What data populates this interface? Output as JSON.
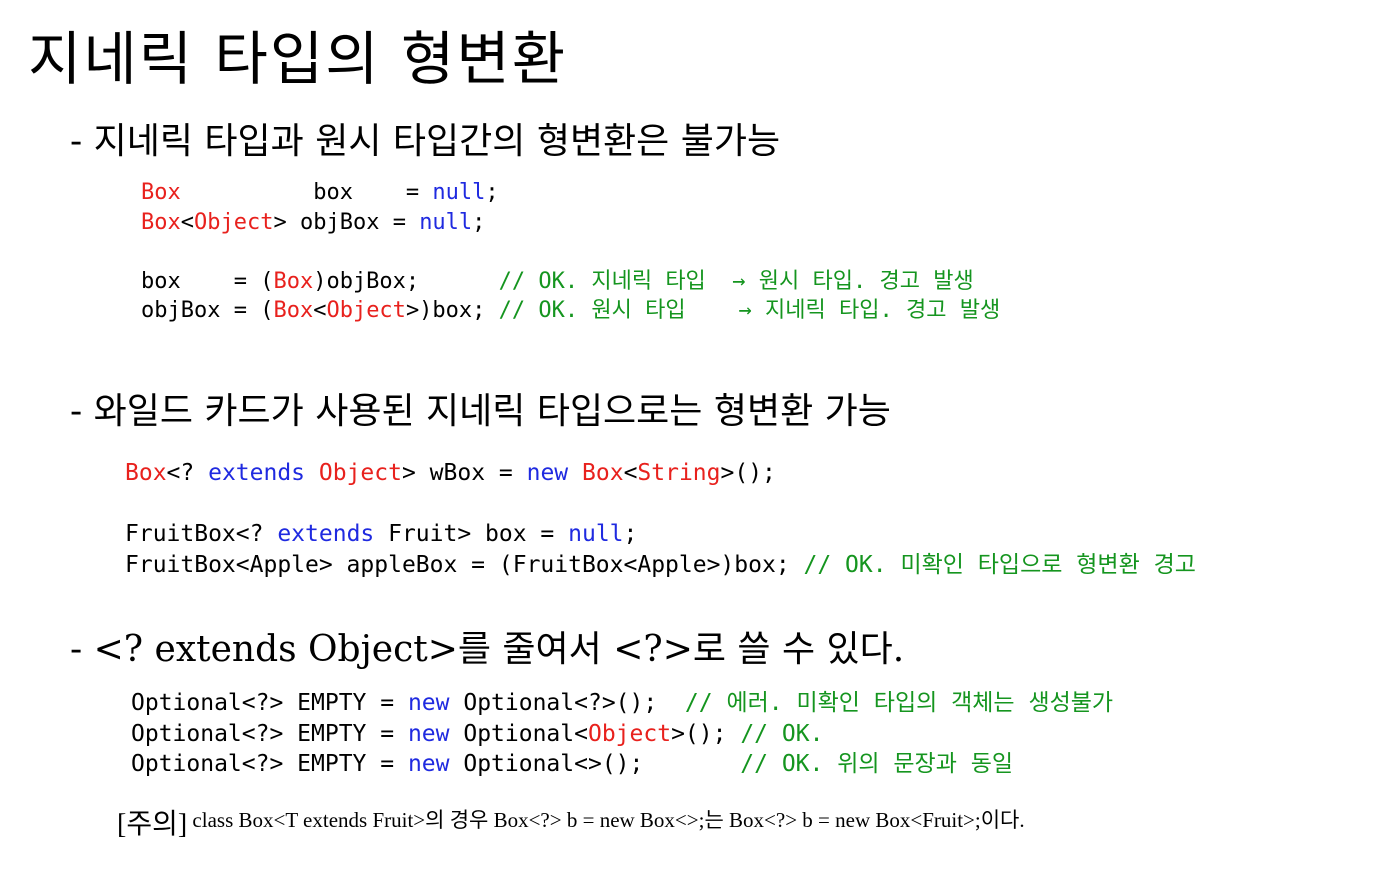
{
  "title": "지네릭 타입의 형변환",
  "sections": [
    {
      "heading": "- 지네릭 타입과 원시 타입간의 형변환은 불가능",
      "code": [
        [
          [
            "red",
            "Box"
          ],
          [
            "plain",
            "          box    = "
          ],
          [
            "blue",
            "null"
          ],
          [
            "plain",
            ";"
          ]
        ],
        [
          [
            "red",
            "Box"
          ],
          [
            "plain",
            "<"
          ],
          [
            "red",
            "Object"
          ],
          [
            "plain",
            "> objBox = "
          ],
          [
            "blue",
            "null"
          ],
          [
            "plain",
            ";"
          ]
        ],
        [
          [
            "plain",
            " "
          ]
        ],
        [
          [
            "plain",
            "box    = ("
          ],
          [
            "red",
            "Box"
          ],
          [
            "plain",
            ")objBox;      "
          ],
          [
            "green",
            "// OK. 지네릭 타입  → 원시 타입. 경고 발생"
          ]
        ],
        [
          [
            "plain",
            "objBox = ("
          ],
          [
            "red",
            "Box"
          ],
          [
            "plain",
            "<"
          ],
          [
            "red",
            "Object"
          ],
          [
            "plain",
            ">)box; "
          ],
          [
            "green",
            "// OK. 원시 타입    → 지네릭 타입. 경고 발생"
          ]
        ]
      ]
    },
    {
      "heading": "- 와일드 카드가 사용된 지네릭 타입으로는 형변환 가능",
      "code": [
        [
          [
            "red",
            "Box"
          ],
          [
            "plain",
            "<? "
          ],
          [
            "blue",
            "extends"
          ],
          [
            "plain",
            " "
          ],
          [
            "red",
            "Object"
          ],
          [
            "plain",
            "> wBox = "
          ],
          [
            "blue",
            "new"
          ],
          [
            "plain",
            " "
          ],
          [
            "red",
            "Box"
          ],
          [
            "plain",
            "<"
          ],
          [
            "red",
            "String"
          ],
          [
            "plain",
            ">();"
          ]
        ],
        [
          [
            "plain",
            " "
          ]
        ],
        [
          [
            "plain",
            "FruitBox<? "
          ],
          [
            "blue",
            "extends"
          ],
          [
            "plain",
            " Fruit> box = "
          ],
          [
            "blue",
            "null"
          ],
          [
            "plain",
            ";"
          ]
        ],
        [
          [
            "plain",
            "FruitBox<Apple> appleBox = (FruitBox<Apple>)box; "
          ],
          [
            "green",
            "// OK. 미확인 타입으로 형변환 경고"
          ]
        ]
      ]
    },
    {
      "heading": "- <? extends Object>를 줄여서 <?>로 쓸 수 있다.",
      "code": [
        [
          [
            "plain",
            "Optional<?> EMPTY = "
          ],
          [
            "blue",
            "new"
          ],
          [
            "plain",
            " Optional<?>();  "
          ],
          [
            "green",
            "// 에러. 미확인 타입의 객체는 생성불가"
          ]
        ],
        [
          [
            "plain",
            "Optional<?> EMPTY = "
          ],
          [
            "blue",
            "new"
          ],
          [
            "plain",
            " Optional<"
          ],
          [
            "red",
            "Object"
          ],
          [
            "plain",
            ">(); "
          ],
          [
            "green",
            "// OK."
          ]
        ],
        [
          [
            "plain",
            "Optional<?> EMPTY = "
          ],
          [
            "blue",
            "new"
          ],
          [
            "plain",
            " Optional<>();       "
          ],
          [
            "green",
            "// OK. 위의 문장과 동일"
          ]
        ]
      ]
    }
  ],
  "note": {
    "bracket": "[주의]",
    "text": " class Box<T extends Fruit>의 경우 Box<?> b = new Box<>;는 Box<?> b = new Box<Fruit>;이다."
  }
}
